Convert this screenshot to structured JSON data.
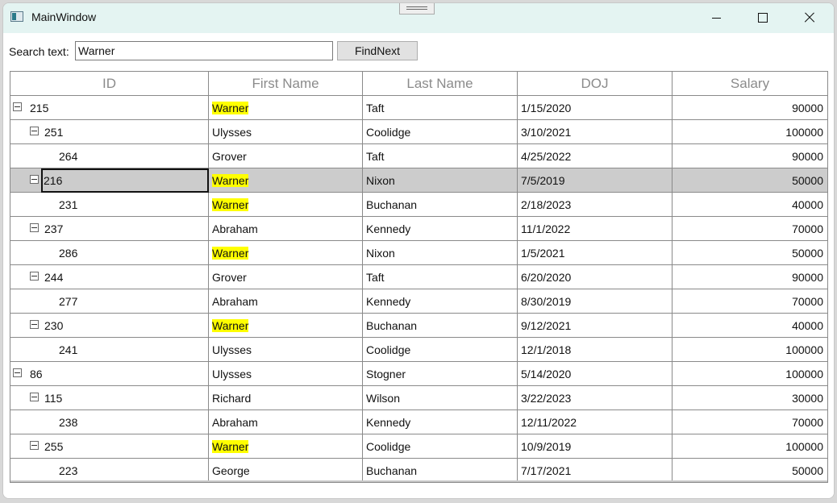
{
  "window": {
    "title": "MainWindow"
  },
  "search": {
    "label": "Search text:",
    "value": "Warner",
    "button": "FindNext"
  },
  "grid": {
    "columns": [
      "ID",
      "First Name",
      "Last Name",
      "DOJ",
      "Salary"
    ],
    "highlight_color": "#ffff00",
    "selected_row_color": "#cccccc",
    "rows": [
      {
        "id": "215",
        "first": "Warner",
        "last": "Taft",
        "doj": "1/15/2020",
        "salary": "90000",
        "level": 0,
        "expandable": true,
        "highlight": true
      },
      {
        "id": "251",
        "first": "Ulysses",
        "last": "Coolidge",
        "doj": "3/10/2021",
        "salary": "100000",
        "level": 1,
        "expandable": true,
        "highlight": false
      },
      {
        "id": "264",
        "first": "Grover",
        "last": "Taft",
        "doj": "4/25/2022",
        "salary": "90000",
        "level": 2,
        "expandable": false,
        "highlight": false
      },
      {
        "id": "216",
        "first": "Warner",
        "last": "Nixon",
        "doj": "7/5/2019",
        "salary": "50000",
        "level": 1,
        "expandable": true,
        "highlight": true,
        "selected": true
      },
      {
        "id": "231",
        "first": "Warner",
        "last": "Buchanan",
        "doj": "2/18/2023",
        "salary": "40000",
        "level": 2,
        "expandable": false,
        "highlight": true
      },
      {
        "id": "237",
        "first": "Abraham",
        "last": "Kennedy",
        "doj": "11/1/2022",
        "salary": "70000",
        "level": 1,
        "expandable": true,
        "highlight": false
      },
      {
        "id": "286",
        "first": "Warner",
        "last": "Nixon",
        "doj": "1/5/2021",
        "salary": "50000",
        "level": 2,
        "expandable": false,
        "highlight": true
      },
      {
        "id": "244",
        "first": "Grover",
        "last": "Taft",
        "doj": "6/20/2020",
        "salary": "90000",
        "level": 1,
        "expandable": true,
        "highlight": false
      },
      {
        "id": "277",
        "first": "Abraham",
        "last": "Kennedy",
        "doj": "8/30/2019",
        "salary": "70000",
        "level": 2,
        "expandable": false,
        "highlight": false
      },
      {
        "id": "230",
        "first": "Warner",
        "last": "Buchanan",
        "doj": "9/12/2021",
        "salary": "40000",
        "level": 1,
        "expandable": true,
        "highlight": true
      },
      {
        "id": "241",
        "first": "Ulysses",
        "last": "Coolidge",
        "doj": "12/1/2018",
        "salary": "100000",
        "level": 2,
        "expandable": false,
        "highlight": false
      },
      {
        "id": "86",
        "first": "Ulysses",
        "last": "Stogner",
        "doj": "5/14/2020",
        "salary": "100000",
        "level": 0,
        "expandable": true,
        "highlight": false
      },
      {
        "id": "115",
        "first": "Richard",
        "last": "Wilson",
        "doj": "3/22/2023",
        "salary": "30000",
        "level": 1,
        "expandable": true,
        "highlight": false
      },
      {
        "id": "238",
        "first": "Abraham",
        "last": "Kennedy",
        "doj": "12/11/2022",
        "salary": "70000",
        "level": 2,
        "expandable": false,
        "highlight": false
      },
      {
        "id": "255",
        "first": "Warner",
        "last": "Coolidge",
        "doj": "10/9/2019",
        "salary": "100000",
        "level": 1,
        "expandable": true,
        "highlight": true
      },
      {
        "id": "223",
        "first": "George",
        "last": "Buchanan",
        "doj": "7/17/2021",
        "salary": "50000",
        "level": 2,
        "expandable": false,
        "highlight": false
      }
    ]
  }
}
